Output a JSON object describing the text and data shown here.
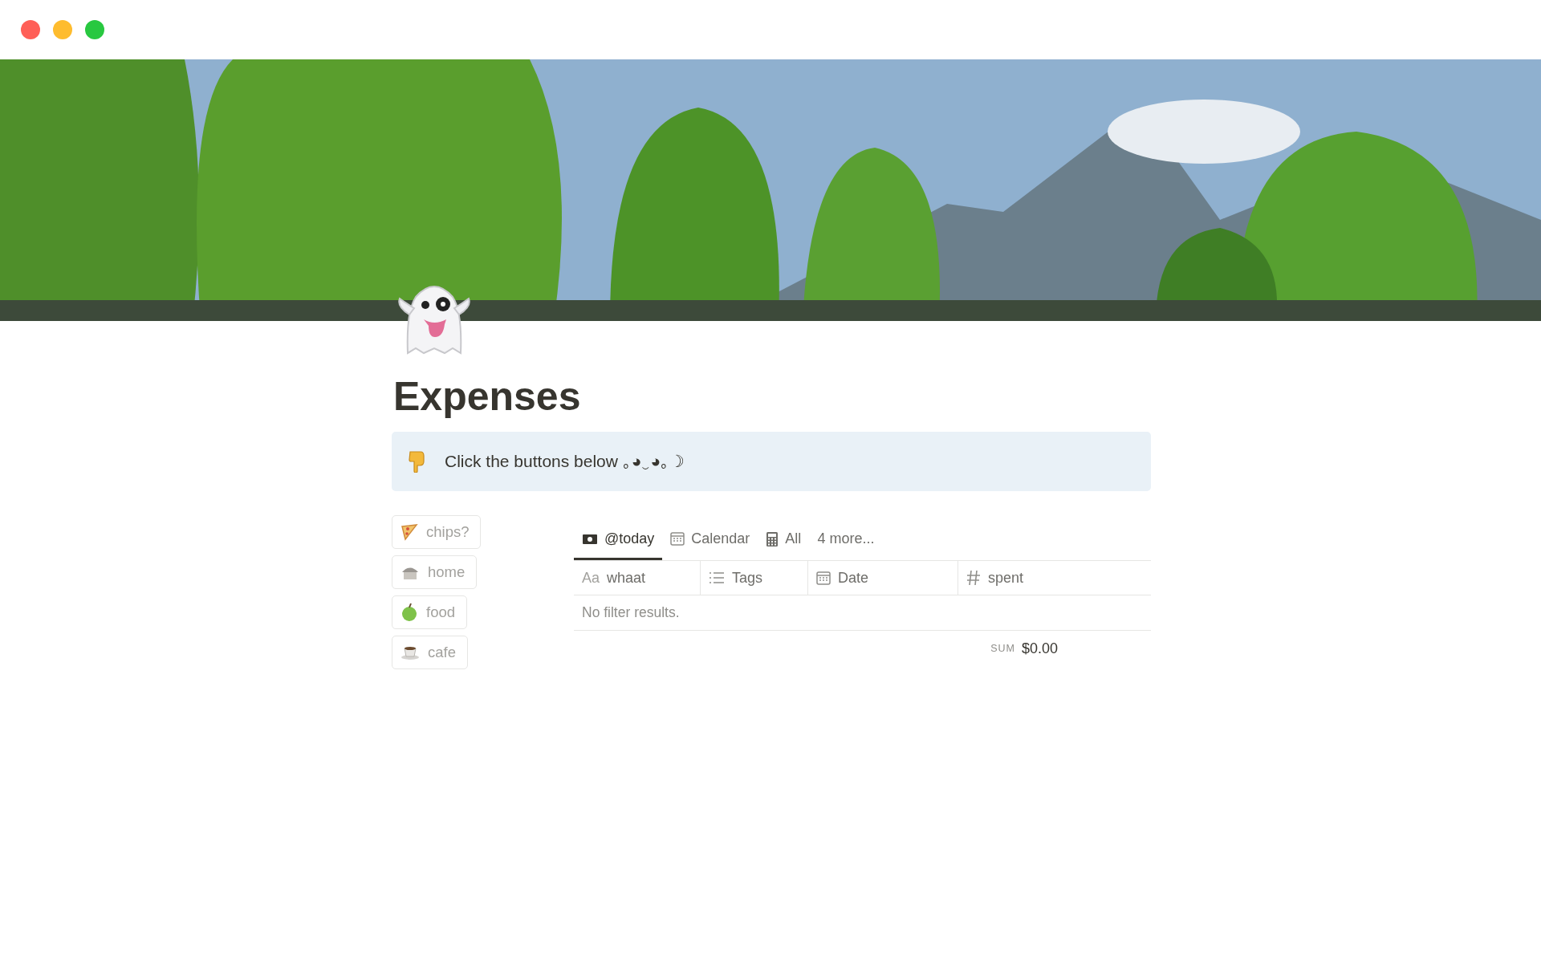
{
  "window": {
    "controls": [
      {
        "color": "#ff5f57"
      },
      {
        "color": "#febc2e"
      },
      {
        "color": "#28c840"
      }
    ]
  },
  "title": "Expenses",
  "callout": {
    "text": "Click the buttons below ｡◕‿◕｡☽"
  },
  "buttons": [
    {
      "label": "chips?"
    },
    {
      "label": "home"
    },
    {
      "label": "food"
    },
    {
      "label": "cafe"
    }
  ],
  "tabs": [
    {
      "label": "@today",
      "selected": true
    },
    {
      "label": "Calendar",
      "selected": false
    },
    {
      "label": "All",
      "selected": false
    },
    {
      "label": "4 more...",
      "selected": false
    }
  ],
  "table": {
    "columns": [
      {
        "prefix": "Aa",
        "label": "whaat"
      },
      {
        "label": "Tags"
      },
      {
        "label": "Date"
      },
      {
        "label": "spent"
      }
    ],
    "empty_message": "No filter results.",
    "sum_label": "SUM",
    "sum_value": "$0.00"
  }
}
